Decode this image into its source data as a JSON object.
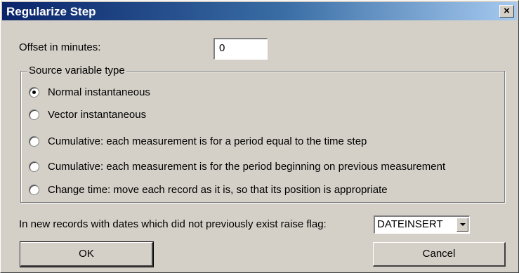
{
  "window": {
    "title": "Regularize Step",
    "close_label": "×"
  },
  "offset": {
    "label": "Offset in minutes:",
    "value": "0"
  },
  "source_group": {
    "legend": "Source variable type",
    "options": [
      {
        "label": "Normal instantaneous",
        "checked": true
      },
      {
        "label": "Vector instantaneous",
        "checked": false
      },
      {
        "label": "Cumulative: each measurement is for a period equal to the time step",
        "checked": false
      },
      {
        "label": "Cumulative: each measurement is for the period beginning on previous measurement",
        "checked": false
      },
      {
        "label": "Change time: move each record as it is, so that its position is appropriate",
        "checked": false
      }
    ]
  },
  "flag": {
    "label": "In new records with dates which did not previously exist raise flag:",
    "selected": "DATEINSERT"
  },
  "buttons": {
    "ok": "OK",
    "cancel": "Cancel"
  }
}
